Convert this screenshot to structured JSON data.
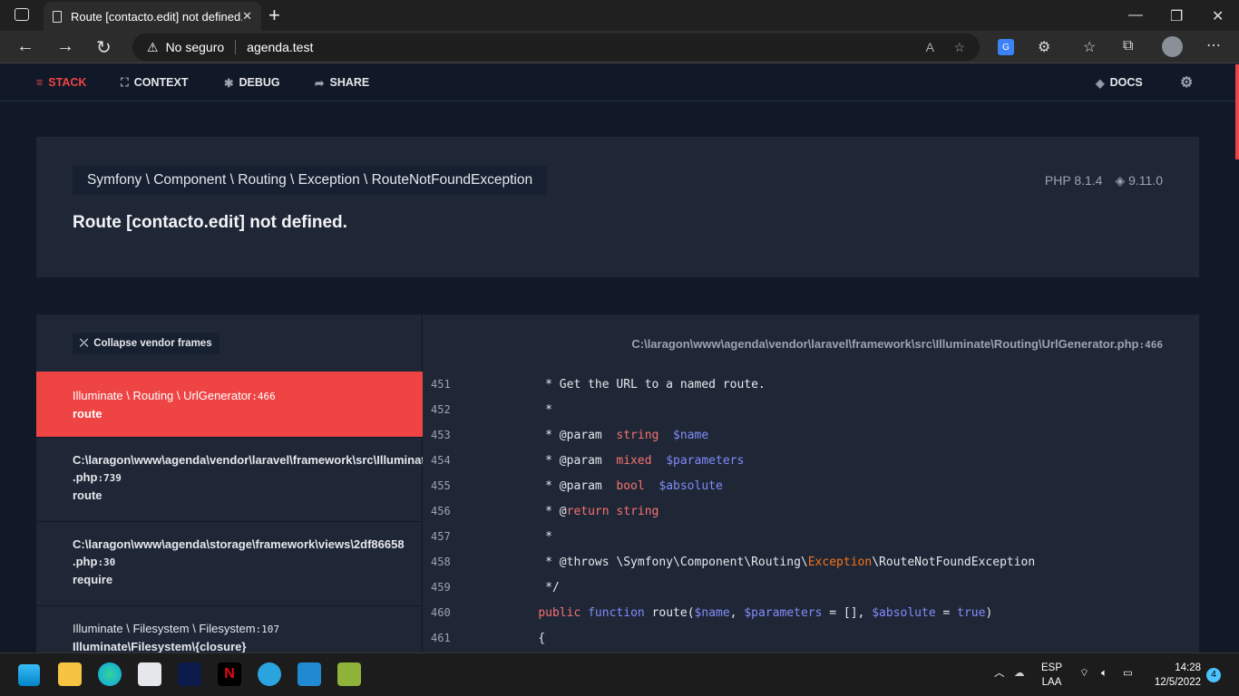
{
  "browser": {
    "tab_title": "Route [contacto.edit] not defined.",
    "security": "No seguro",
    "url": "agenda.test"
  },
  "nav": {
    "stack": "STACK",
    "context": "CONTEXT",
    "debug": "DEBUG",
    "share": "SHARE",
    "docs": "DOCS"
  },
  "exception": {
    "class": "Symfony \\ Component \\ Routing \\ Exception \\ RouteNotFoundException",
    "message": "Route [contacto.edit] not defined.",
    "php_version": "PHP 8.1.4",
    "laravel_version": "9.11.0"
  },
  "stack": {
    "collapse_label": "Collapse vendor frames",
    "frames": [
      {
        "file": "Illuminate \\ Routing \\ UrlGenerator",
        "line": ":466",
        "fn": "route"
      },
      {
        "file": "C:\\laragon\\www\\agenda\\vendor\\laravel\\framework\\src\\Illuminate\\Routing\\UrlGenerator",
        "ext": ".php",
        "line": ":739",
        "fn": "route"
      },
      {
        "file": "C:\\laragon\\www\\agenda\\storage\\framework\\views\\2df86658",
        "ext": ".php",
        "line": ":30",
        "fn": "require"
      },
      {
        "file": "Illuminate \\ Filesystem \\ Filesystem",
        "line": ":107",
        "fn": "Illuminate\\Filesystem\\{closure}"
      }
    ],
    "path": "C:\\laragon\\www\\agenda\\vendor\\laravel\\framework\\src\\Illuminate\\Routing\\UrlGenerator.php",
    "path_line": ":466",
    "code": [
      {
        "n": "451",
        "tokens": [
          [
            "def",
            "     * Get the URL to a named route."
          ]
        ]
      },
      {
        "n": "452",
        "tokens": [
          [
            "def",
            "     *"
          ]
        ]
      },
      {
        "n": "453",
        "tokens": [
          [
            "def",
            "     * @param  "
          ],
          [
            "red",
            "string"
          ],
          [
            "def",
            "  "
          ],
          [
            "pur",
            "$name"
          ]
        ]
      },
      {
        "n": "454",
        "tokens": [
          [
            "def",
            "     * @param  "
          ],
          [
            "red",
            "mixed"
          ],
          [
            "def",
            "  "
          ],
          [
            "pur",
            "$parameters"
          ]
        ]
      },
      {
        "n": "455",
        "tokens": [
          [
            "def",
            "     * @param  "
          ],
          [
            "red",
            "bool"
          ],
          [
            "def",
            "  "
          ],
          [
            "pur",
            "$absolute"
          ]
        ]
      },
      {
        "n": "456",
        "tokens": [
          [
            "def",
            "     * @"
          ],
          [
            "red",
            "return string"
          ]
        ]
      },
      {
        "n": "457",
        "tokens": [
          [
            "def",
            "     *"
          ]
        ]
      },
      {
        "n": "458",
        "tokens": [
          [
            "def",
            "     * @throws \\Symfony\\Component\\Routing\\"
          ],
          [
            "org",
            "Exception"
          ],
          [
            "def",
            "\\RouteNotFoundException"
          ]
        ]
      },
      {
        "n": "459",
        "tokens": [
          [
            "def",
            "     */"
          ]
        ]
      },
      {
        "n": "460",
        "tokens": [
          [
            "def",
            "    "
          ],
          [
            "red",
            "public "
          ],
          [
            "pur",
            "function "
          ],
          [
            "def",
            "route("
          ],
          [
            "pur",
            "$name"
          ],
          [
            "def",
            ", "
          ],
          [
            "pur",
            "$parameters"
          ],
          [
            "def",
            " = [], "
          ],
          [
            "pur",
            "$absolute"
          ],
          [
            "def",
            " = "
          ],
          [
            "pur",
            "true"
          ],
          [
            "def",
            ")"
          ]
        ]
      },
      {
        "n": "461",
        "tokens": [
          [
            "def",
            "    {"
          ]
        ]
      }
    ]
  },
  "taskbar": {
    "lang1": "ESP",
    "lang2": "LAA",
    "time": "14:28",
    "date": "12/5/2022",
    "notifications": "4"
  },
  "colors": {
    "accent": "#ef4444",
    "page_bg": "#111827",
    "card_bg": "#1f2737"
  }
}
